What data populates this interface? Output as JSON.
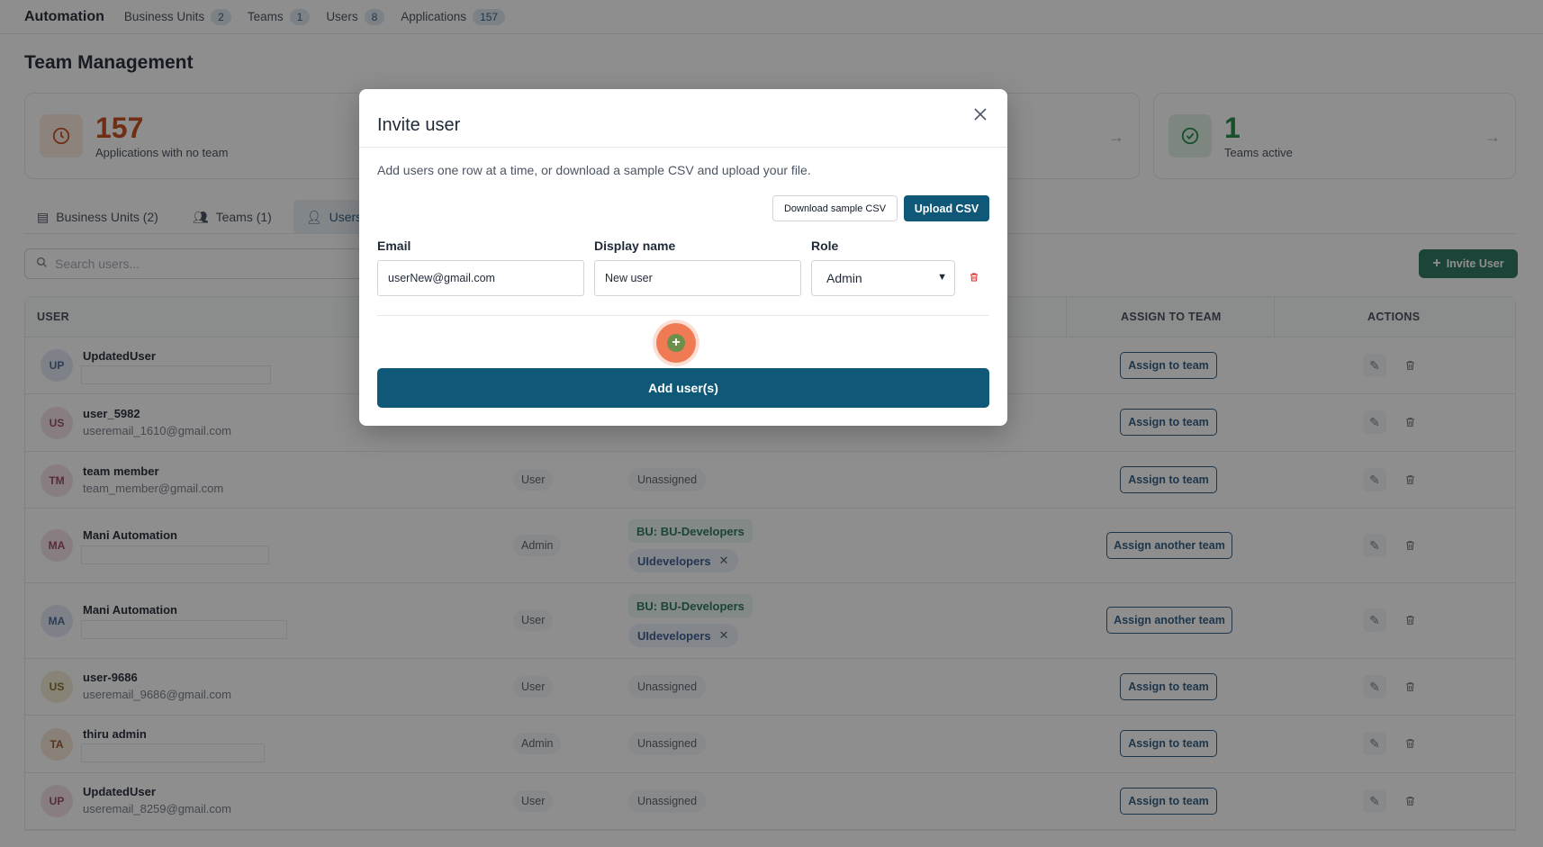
{
  "topbar": {
    "brand": "Automation",
    "nav": [
      {
        "label": "Business Units",
        "count": "2"
      },
      {
        "label": "Teams",
        "count": "1"
      },
      {
        "label": "Users",
        "count": "8"
      },
      {
        "label": "Applications",
        "count": "157"
      }
    ]
  },
  "page_title": "Team Management",
  "stats": [
    {
      "value": "157",
      "label": "Applications with no team",
      "color": "#c2410c"
    },
    {
      "value": "1",
      "label": "Teams active",
      "color": "#15803d"
    }
  ],
  "tabs": [
    {
      "label": "Business Units (2)"
    },
    {
      "label": "Teams (1)"
    },
    {
      "label": "Users"
    }
  ],
  "search": {
    "placeholder": "Search users..."
  },
  "invite_button": "Invite User",
  "table": {
    "headers": {
      "user": "USER",
      "assign": "ASSIGN TO TEAM",
      "actions": "ACTIONS"
    },
    "rows": [
      {
        "initials": "UP",
        "name": "UpdatedUser",
        "email": "",
        "role": "",
        "status": "",
        "bu": "",
        "team": "",
        "action": "Assign to team"
      },
      {
        "initials": "US",
        "name": "user_5982",
        "email": "useremail_1610@gmail.com",
        "role": "",
        "status": "",
        "bu": "",
        "team": "",
        "action": "Assign to team"
      },
      {
        "initials": "TM",
        "name": "team member",
        "email": "team_member@gmail.com",
        "role": "User",
        "status": "Unassigned",
        "bu": "",
        "team": "",
        "action": "Assign to team"
      },
      {
        "initials": "MA",
        "name": "Mani Automation",
        "email": "",
        "role": "Admin",
        "status": "",
        "bu": "BU: BU-Developers",
        "team": "UIdevelopers",
        "action": "Assign another team"
      },
      {
        "initials": "MA",
        "name": "Mani Automation",
        "email": "",
        "role": "User",
        "status": "",
        "bu": "BU: BU-Developers",
        "team": "UIdevelopers",
        "action": "Assign another team"
      },
      {
        "initials": "US",
        "name": "user-9686",
        "email": "useremail_9686@gmail.com",
        "role": "User",
        "status": "Unassigned",
        "bu": "",
        "team": "",
        "action": "Assign to team"
      },
      {
        "initials": "TA",
        "name": "thiru admin",
        "email": "",
        "role": "Admin",
        "status": "Unassigned",
        "bu": "",
        "team": "",
        "action": "Assign to team"
      },
      {
        "initials": "UP",
        "name": "UpdatedUser",
        "email": "useremail_8259@gmail.com",
        "role": "User",
        "status": "Unassigned",
        "bu": "",
        "team": "",
        "action": "Assign to team"
      }
    ]
  },
  "modal": {
    "title": "Invite user",
    "hint": "Add users one row at a time, or download a sample CSV and upload your file.",
    "download_csv": "Download sample CSV",
    "upload_csv": "Upload CSV",
    "labels": {
      "email": "Email",
      "display_name": "Display name",
      "role": "Role"
    },
    "row": {
      "email": "userNew@gmail.com",
      "display_name": "New user",
      "role": "Admin"
    },
    "submit": "Add user(s)"
  }
}
